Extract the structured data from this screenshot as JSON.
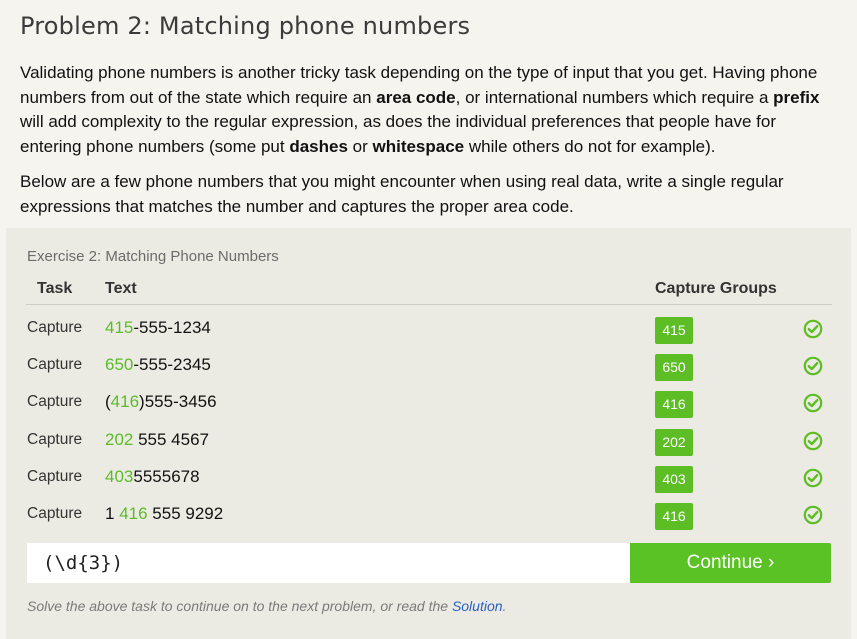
{
  "title": "Problem 2: Matching phone numbers",
  "intro": {
    "t1": "Validating phone numbers is another tricky task depending on the type of input that you get. Having phone numbers from out of the state which require an ",
    "b1": "area code",
    "t2": ", or international numbers which require a ",
    "b2": "prefix",
    "t3": " will add complexity to the regular expression, as does the individual preferences that people have for entering phone numbers (some put ",
    "b3": "dashes",
    "t4": " or ",
    "b4": "whitespace",
    "t5": " while others do not for example)."
  },
  "instructions": "Below are a few phone numbers that you might encounter when using real data, write a single regular expressions that matches the number and captures the proper area code.",
  "exercise": {
    "title": "Exercise 2: Matching Phone Numbers",
    "headers": {
      "task": "Task",
      "text": "Text",
      "capture": "Capture Groups"
    },
    "rows": [
      {
        "task": "Capture",
        "pre": "",
        "hl": "415",
        "post": "-555-1234",
        "group": "415",
        "status": "check-circle-icon"
      },
      {
        "task": "Capture",
        "pre": "",
        "hl": "650",
        "post": "-555-2345",
        "group": "650",
        "status": "check-circle-icon"
      },
      {
        "task": "Capture",
        "pre": "(",
        "hl": "416",
        "post": ")555-3456",
        "group": "416",
        "status": "check-circle-icon"
      },
      {
        "task": "Capture",
        "pre": "",
        "hl": "202",
        "post": " 555 4567",
        "group": "202",
        "status": "check-circle-icon"
      },
      {
        "task": "Capture",
        "pre": "",
        "hl": "403",
        "post": "5555678",
        "group": "403",
        "status": "check-circle-icon"
      },
      {
        "task": "Capture",
        "pre": "1 ",
        "hl": "416",
        "post": " 555 9292",
        "group": "416",
        "status": "check-circle-icon"
      }
    ],
    "input_value": "(\\d{3})",
    "continue_label": "Continue ›",
    "footnote_pre": "Solve the above task to continue on to the next problem, or read the ",
    "footnote_link": "Solution",
    "footnote_post": "."
  },
  "colors": {
    "accent_green": "#5cbd25",
    "match_highlight": "#5cbb2a",
    "link_blue": "#2a5ec8"
  }
}
